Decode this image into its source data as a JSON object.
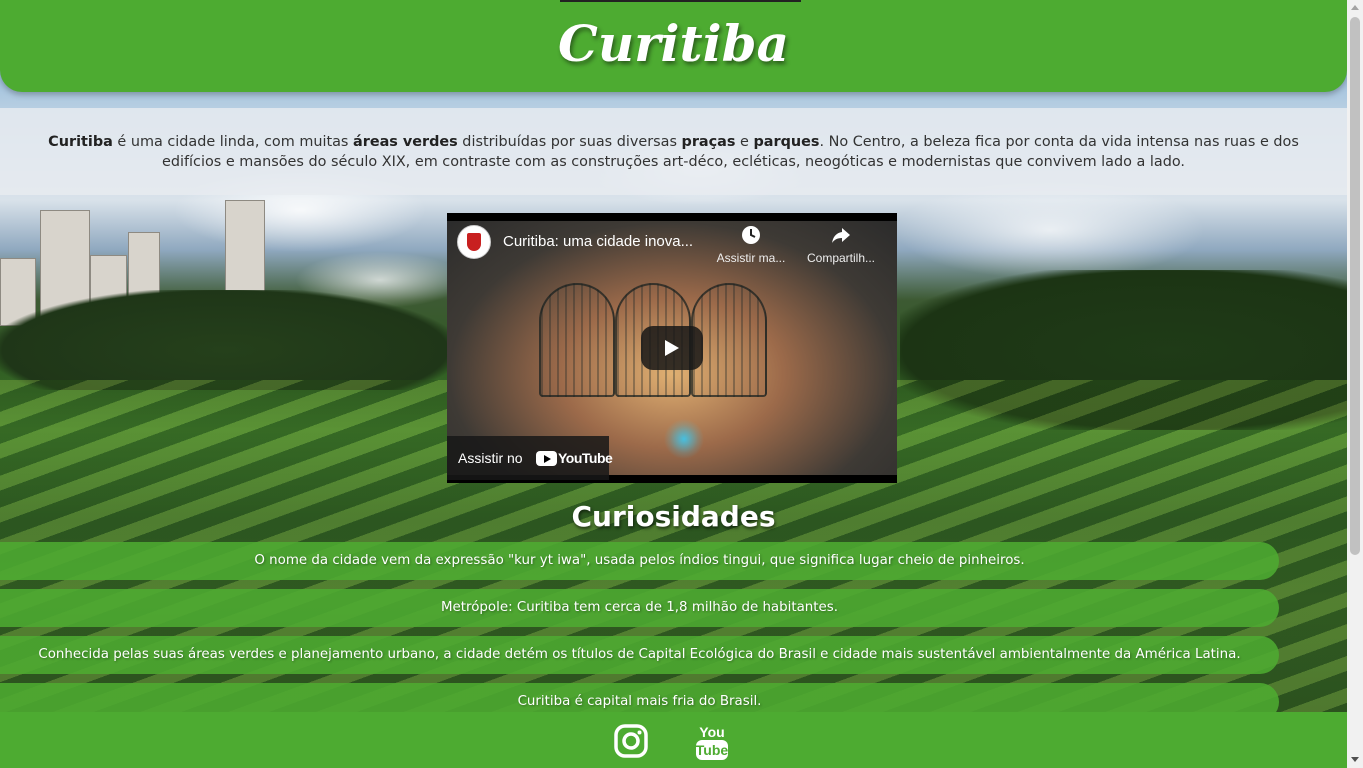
{
  "header": {
    "title": "Curitiba"
  },
  "intro": {
    "parts": [
      {
        "text": "Curitiba",
        "bold": true
      },
      {
        "text": " é uma cidade linda, com muitas ",
        "bold": false
      },
      {
        "text": "áreas verdes",
        "bold": true
      },
      {
        "text": " distribuídas por suas diversas ",
        "bold": false
      },
      {
        "text": "praças",
        "bold": true
      },
      {
        "text": " e ",
        "bold": false
      },
      {
        "text": "parques",
        "bold": true
      },
      {
        "text": ". No Centro, a beleza fica por conta da vida intensa nas ruas e dos edifícios e mansões do século XIX, em contraste com as construções art-déco, ecléticas, neogóticas e modernistas que convivem lado a lado.",
        "bold": false
      }
    ]
  },
  "video": {
    "title": "Curitiba: uma cidade inova...",
    "watch_later_label": "Assistir ma...",
    "share_label": "Compartilh...",
    "watch_on_label": "Assistir no",
    "youtube_label": "YouTube",
    "icons": {
      "channel": "channel-logo-icon",
      "watch_later": "clock-icon",
      "share": "share-arrow-icon",
      "play": "play-icon"
    }
  },
  "curiosidades": {
    "title": "Curiosidades",
    "items": [
      "O nome da cidade vem da expressão \"kur yt iwa\", usada pelos índios tingui, que significa lugar cheio de pinheiros.",
      "Metrópole: Curitiba tem cerca de 1,8 milhão de habitantes.",
      "Conhecida pelas suas áreas verdes e planejamento urbano, a cidade detém os títulos de Capital Ecológica do Brasil e cidade mais sustentável ambientalmente da América Latina.",
      "Curitiba é capital mais fria do Brasil."
    ]
  },
  "footer": {
    "social": [
      {
        "icon": "instagram-icon"
      },
      {
        "icon": "youtube-icon",
        "text_top": "You",
        "text_bottom": "Tube"
      }
    ]
  },
  "colors": {
    "brand_green": "#4dab31",
    "text_dark": "#333333",
    "white": "#ffffff"
  }
}
